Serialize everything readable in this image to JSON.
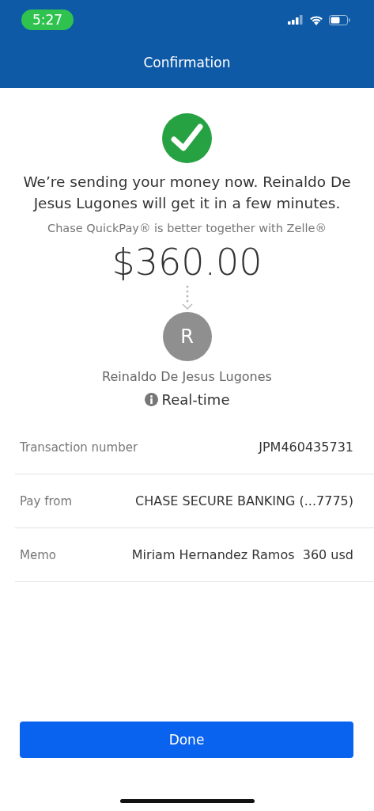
{
  "status_bar": {
    "time": "5:27"
  },
  "header": {
    "title": "Confirmation"
  },
  "message": "We’re sending your money now. Reinaldo De Jesus Lugones will get it in a few minutes.",
  "subtitle": "Chase QuickPay® is better together with Zelle®",
  "amount": "$360.00",
  "recipient": {
    "initial": "R",
    "name": "Reinaldo De Jesus Lugones"
  },
  "delivery": "Real-time",
  "details": [
    {
      "label": "Transaction number",
      "value": "JPM460435731"
    },
    {
      "label": "Pay from",
      "value": "CHASE SECURE BANKING (...7775)"
    },
    {
      "label": "Memo",
      "value": "Miriam Hernandez Ramos  360 usd"
    }
  ],
  "done_button": "Done"
}
